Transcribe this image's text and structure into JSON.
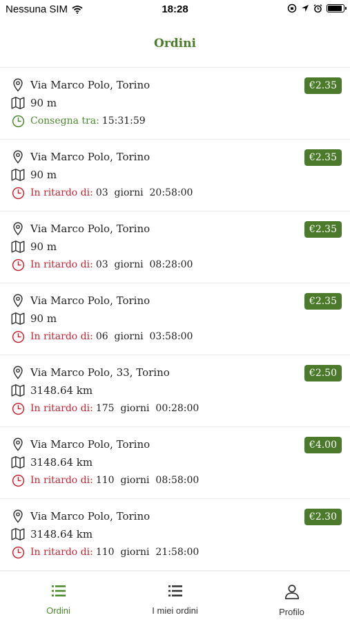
{
  "status_bar": {
    "carrier": "Nessuna SIM",
    "time": "18:28",
    "battery_level": 0.9
  },
  "header": {
    "title": "Ordini"
  },
  "colors": {
    "accent": "#4a7d29",
    "late": "#c9252f",
    "ok": "#4a8a2a",
    "badge": "#4a7a2a"
  },
  "orders": [
    {
      "address": "Via Marco Polo, Torino",
      "distance": "90 m",
      "status": "ok",
      "label": "Consegna tra:",
      "value": "15:31:59",
      "price": "€2.35"
    },
    {
      "address": "Via Marco Polo, Torino",
      "distance": "90 m",
      "status": "late",
      "label": "In ritardo di:",
      "value": "03  giorni  20:58:00",
      "price": "€2.35"
    },
    {
      "address": "Via Marco Polo, Torino",
      "distance": "90 m",
      "status": "late",
      "label": "In ritardo di:",
      "value": "03  giorni  08:28:00",
      "price": "€2.35"
    },
    {
      "address": "Via Marco Polo, Torino",
      "distance": "90 m",
      "status": "late",
      "label": "In ritardo di:",
      "value": "06  giorni  03:58:00",
      "price": "€2.35"
    },
    {
      "address": "Via Marco Polo, 33, Torino",
      "distance": "3148.64 km",
      "status": "late",
      "label": "In ritardo di:",
      "value": "175  giorni  00:28:00",
      "price": "€2.50"
    },
    {
      "address": "Via Marco Polo, Torino",
      "distance": "3148.64 km",
      "status": "late",
      "label": "In ritardo di:",
      "value": "110  giorni  08:58:00",
      "price": "€4.00"
    },
    {
      "address": "Via Marco Polo, Torino",
      "distance": "3148.64 km",
      "status": "late",
      "label": "In ritardo di:",
      "value": "110  giorni  21:58:00",
      "price": "€2.30"
    }
  ],
  "icons": {
    "location": "map-pin-icon",
    "distance": "map-icon",
    "time": "clock-icon"
  },
  "tabs": [
    {
      "label": "Ordini",
      "icon": "list-icon",
      "active": true
    },
    {
      "label": "I miei ordini",
      "icon": "list-icon",
      "active": false
    },
    {
      "label": "Profilo",
      "icon": "user-icon",
      "active": false
    }
  ]
}
